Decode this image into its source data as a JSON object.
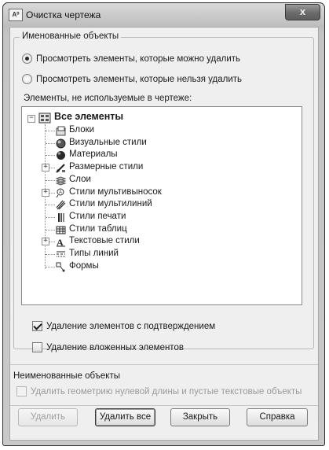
{
  "window": {
    "title": "Очистка чертежа",
    "app_icon_text": "A⁰",
    "close_glyph": "x"
  },
  "named_group": {
    "legend": "Именованные объекты",
    "radio_purgeable": "Просмотреть элементы, которые можно удалить",
    "radio_nonpurgeable": "Просмотреть элементы, которые нельзя удалить",
    "selected": "purgeable",
    "tree_caption": "Элементы, не используемые в чертеже:"
  },
  "tree": {
    "root": "Все элементы",
    "items": [
      {
        "label": "Блоки",
        "icon": "blocks-icon",
        "expandable": false
      },
      {
        "label": "Визуальные стили",
        "icon": "visual-style-sphere-icon",
        "expandable": false
      },
      {
        "label": "Материалы",
        "icon": "material-sphere-icon",
        "expandable": false
      },
      {
        "label": "Размерные стили",
        "icon": "dimension-style-icon",
        "expandable": true
      },
      {
        "label": "Слои",
        "icon": "layers-icon",
        "expandable": false
      },
      {
        "label": "Стили мультивыносок",
        "icon": "multileader-style-icon",
        "expandable": true
      },
      {
        "label": "Стили мультилиний",
        "icon": "multiline-style-icon",
        "expandable": false
      },
      {
        "label": "Стили печати",
        "icon": "plot-style-icon",
        "expandable": false
      },
      {
        "label": "Стили таблиц",
        "icon": "table-style-icon",
        "expandable": false
      },
      {
        "label": "Текстовые стили",
        "icon": "text-style-icon",
        "expandable": true
      },
      {
        "label": "Типы линий",
        "icon": "linetype-icon",
        "expandable": false
      },
      {
        "label": "Формы",
        "icon": "shapes-icon",
        "expandable": false
      }
    ]
  },
  "options": {
    "confirm_label": "Удаление элементов с подтверждением",
    "confirm_checked": true,
    "nested_label": "Удаление вложенных элементов",
    "nested_checked": false
  },
  "unnamed_group": {
    "legend": "Неименованные объекты",
    "zero_length_label": "Удалить геометрию нулевой длины и пустые текстовые объекты",
    "zero_length_checked": false
  },
  "buttons": {
    "purge": "Удалить",
    "purge_all": "Удалить все",
    "close": "Закрыть",
    "help": "Справка"
  }
}
